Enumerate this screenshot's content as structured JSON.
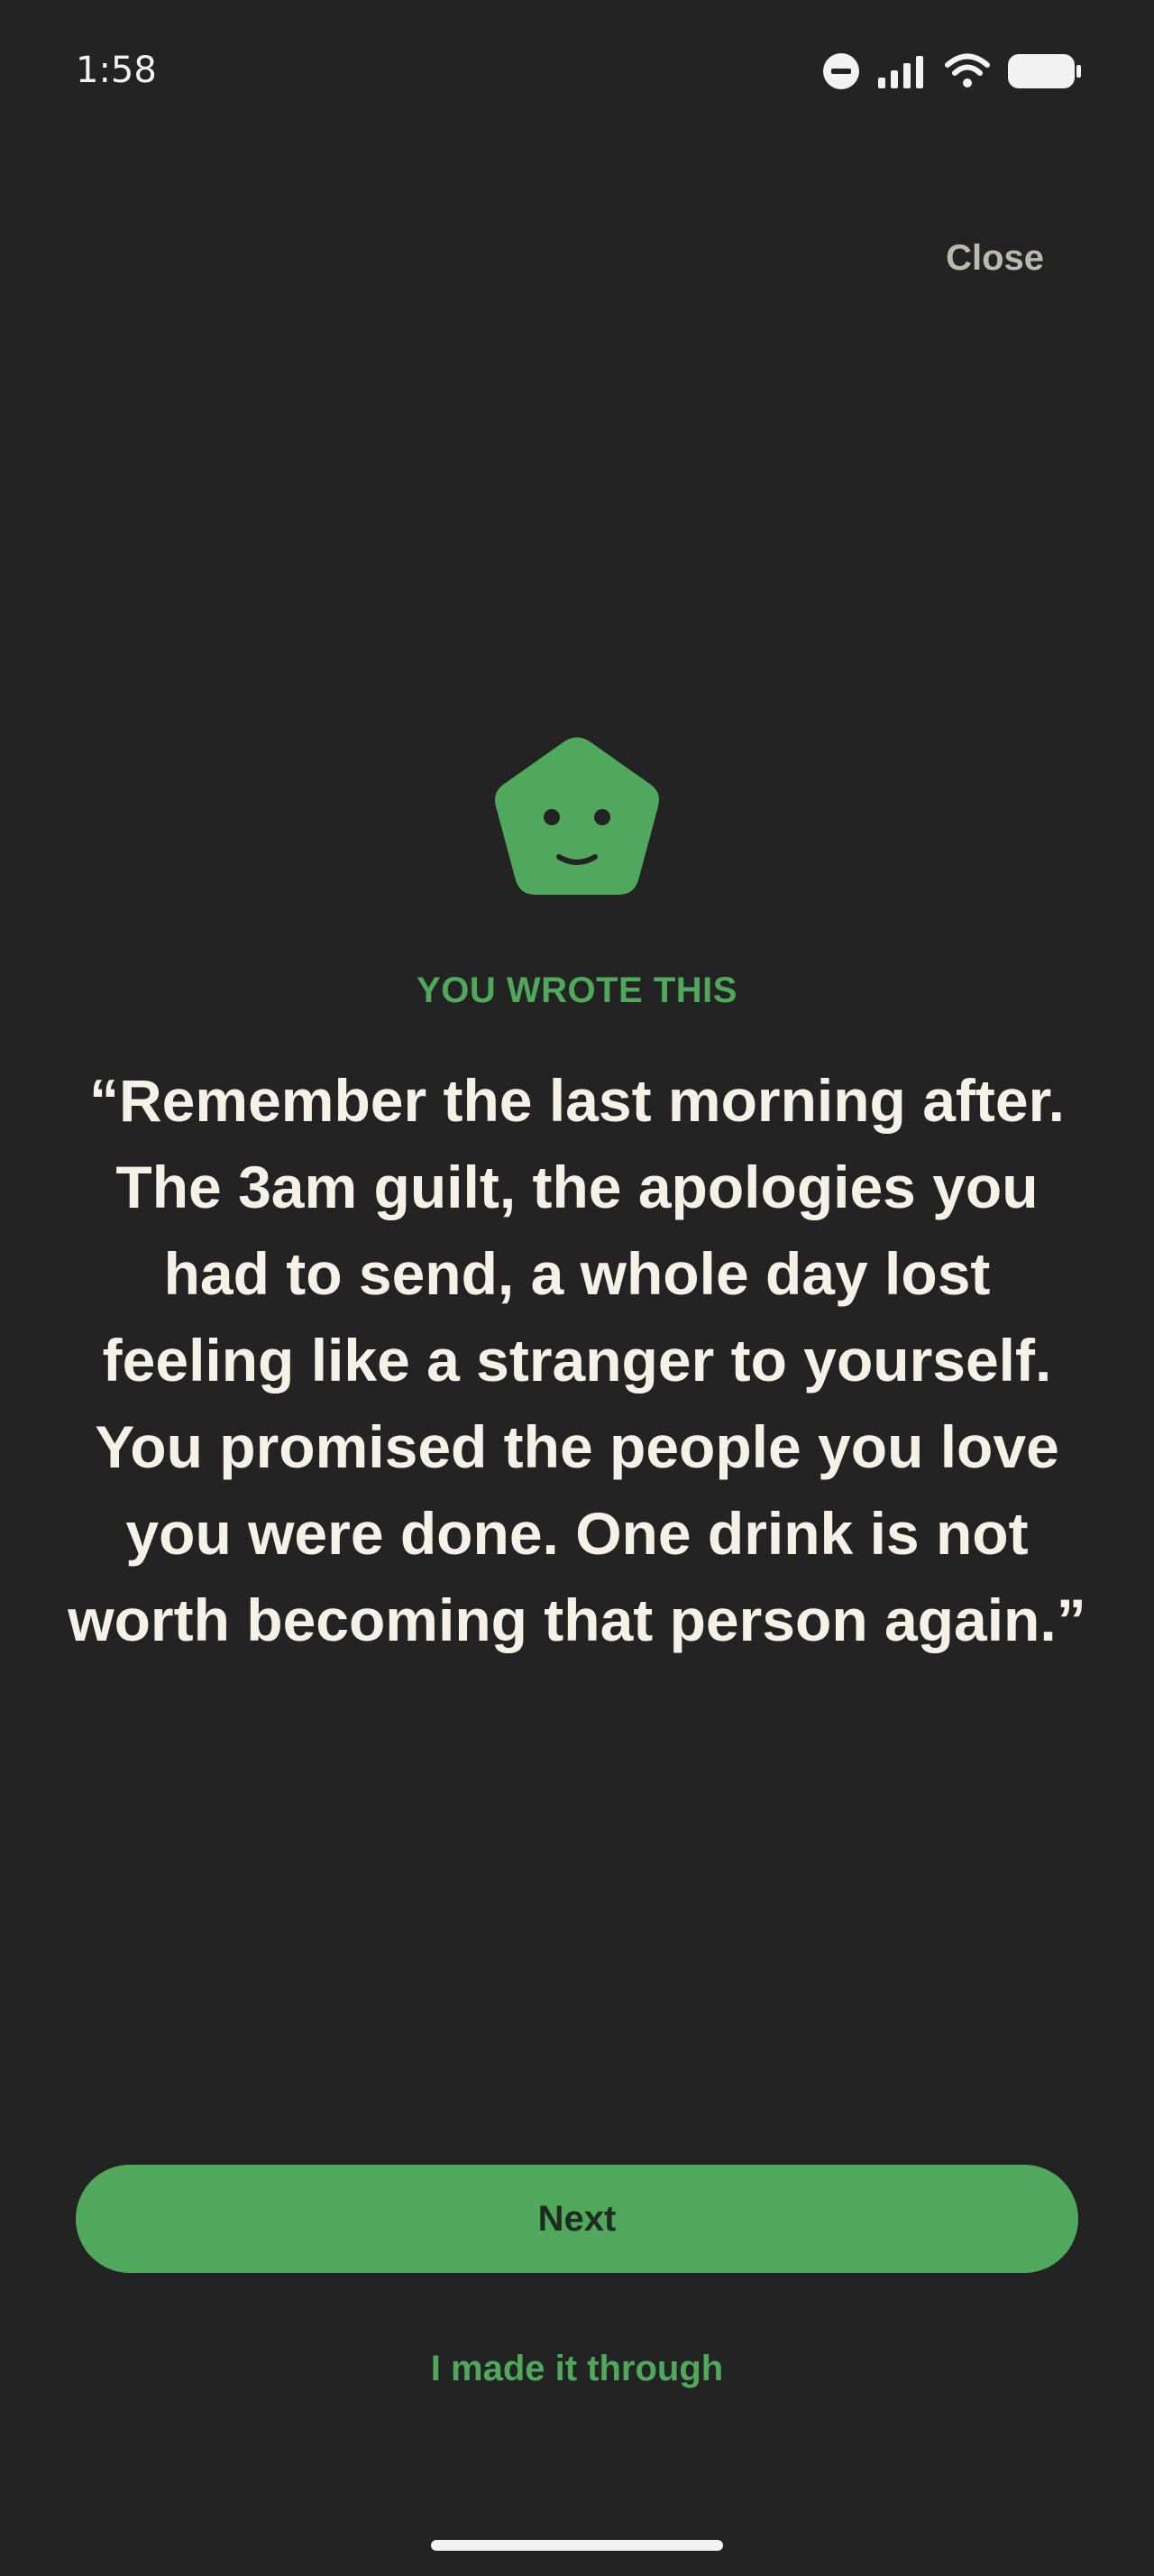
{
  "status_bar": {
    "time": "1:58",
    "icons": [
      "do-not-disturb-icon",
      "signal-icon",
      "wifi-icon",
      "battery-icon"
    ]
  },
  "header": {
    "close_label": "Close"
  },
  "content": {
    "eyebrow": "YOU WROTE THIS",
    "quote": "“Remember the last morning after. The 3am guilt, the apologies you had to send, a whole day lost feeling like a stranger to yourself. You promised the people you love you were done. One drink is not worth becoming that person again.”"
  },
  "actions": {
    "next_label": "Next",
    "made_it_label": "I made it through"
  },
  "colors": {
    "background": "#232323",
    "accent": "#4fa85c",
    "quote_text": "#f4f1e6",
    "close_text": "#b9b9ad"
  }
}
